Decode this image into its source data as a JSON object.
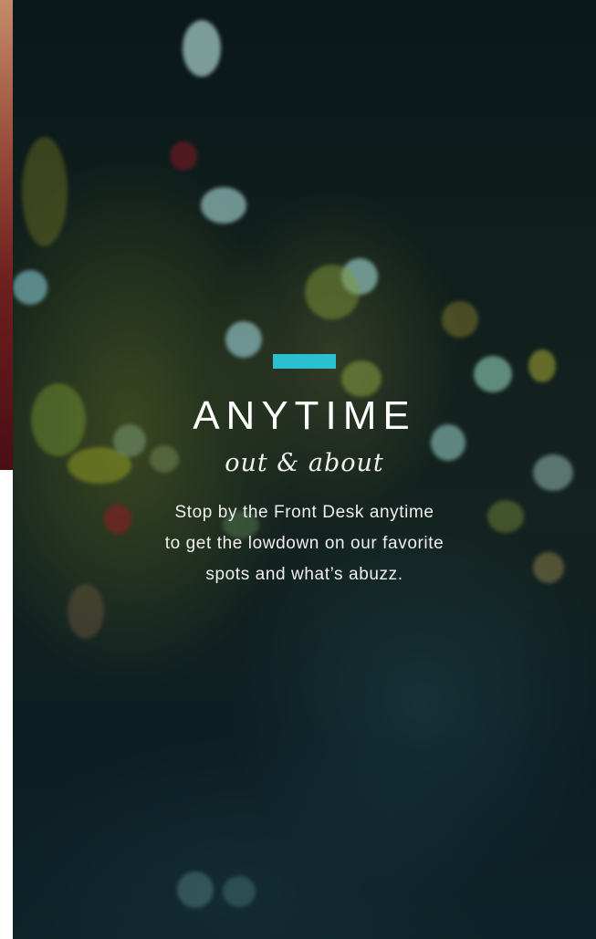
{
  "hero": {
    "accent_color": "#2bc0cd",
    "title": "ANYTIME",
    "subtitle": "out & about",
    "body_lines": [
      "Stop by the Front Desk anytime",
      "to get the lowdown on our favorite",
      "spots and what’s abuzz."
    ]
  }
}
